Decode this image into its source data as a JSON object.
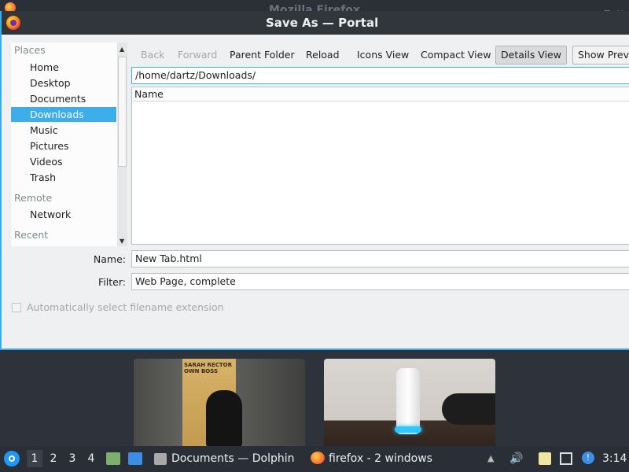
{
  "background_window": {
    "title": "Mozilla Firefox"
  },
  "dialog": {
    "title": "Save As — Portal",
    "places": {
      "places_header": "Places",
      "items": [
        "Home",
        "Desktop",
        "Documents",
        "Downloads",
        "Music",
        "Pictures",
        "Videos",
        "Trash"
      ],
      "selected": "Downloads",
      "remote_header": "Remote",
      "remote_items": [
        "Network"
      ],
      "recent_header": "Recent"
    },
    "toolbar": {
      "back": "Back",
      "forward": "Forward",
      "parent_folder": "Parent Folder",
      "reload": "Reload",
      "icons_view": "Icons View",
      "compact_view": "Compact View",
      "details_view": "Details View",
      "show_preview": "Show Previ"
    },
    "path": "/home/dartz/Downloads/",
    "column_name": "Name",
    "name_label": "Name:",
    "name_value": "New Tab.html",
    "filter_label": "Filter:",
    "filter_value": "Web Page, complete",
    "auto_ext_label": "Automatically select filename extension"
  },
  "previews": {
    "thumb1_text": "SARAH RECTOR\nOWN BOSS"
  },
  "taskbar": {
    "desktops": [
      "1",
      "2",
      "3",
      "4"
    ],
    "current_desktop": "1",
    "tasks": [
      "Documents — Dolphin",
      "firefox - 2 windows"
    ],
    "clock": "3:14"
  },
  "colors": {
    "accent": "#3daee9",
    "panel": "#2a2e36",
    "titlebar": "#31363b"
  }
}
